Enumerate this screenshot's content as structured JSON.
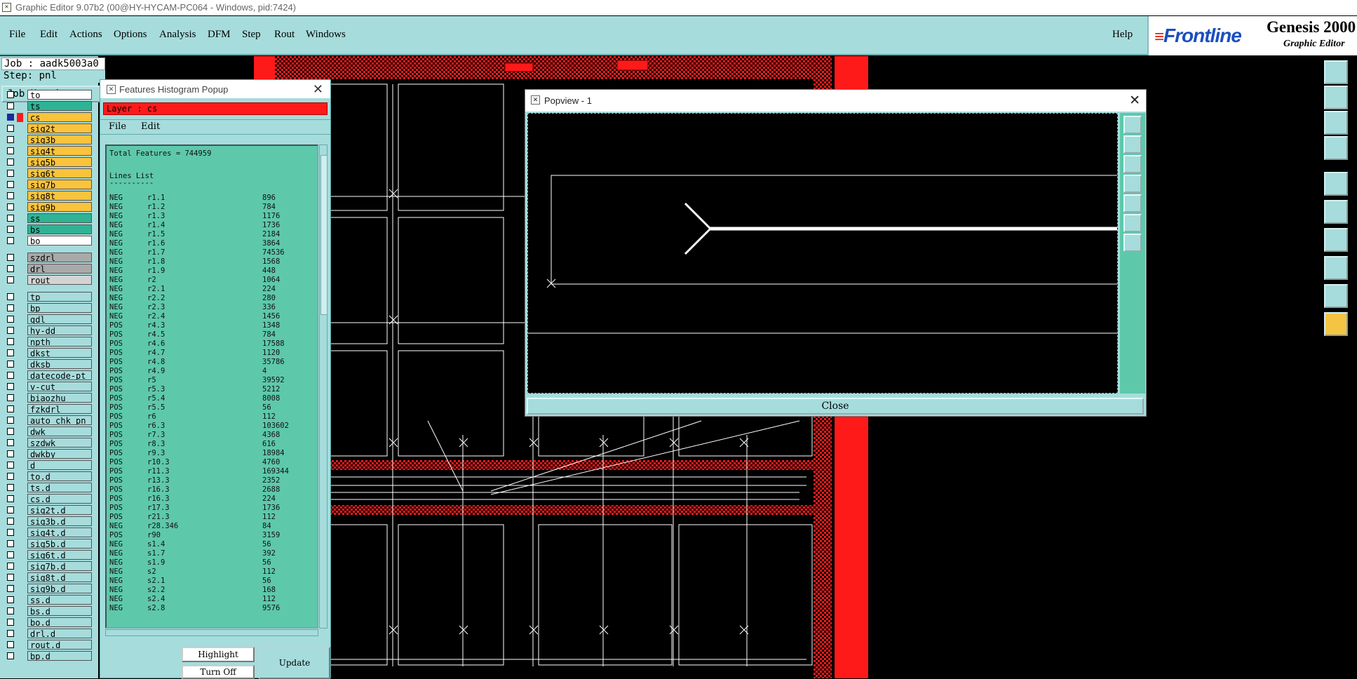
{
  "window": {
    "title": "Graphic Editor 9.07b2 (00@HY-HYCAM-PC064 - Windows, pid:7424)"
  },
  "menubar": {
    "items": [
      "File",
      "Edit",
      "Actions",
      "Options",
      "Analysis",
      "DFM",
      "Step",
      "Rout",
      "Windows"
    ],
    "help": "Help"
  },
  "logo": {
    "brand": "Frontline",
    "product": "Genesis 2000",
    "subtitle": "Graphic Editor"
  },
  "job": {
    "job_line": "Job : aadk5003a0",
    "step_line": "Step: pnl",
    "matrix_button": "Job Matrix ..."
  },
  "layers": [
    {
      "name": "to",
      "color": "#ffffff",
      "selected": false
    },
    {
      "name": "ts",
      "color": "#2fb394",
      "selected": false
    },
    {
      "name": "cs",
      "color": "#f9c33c",
      "selected": true
    },
    {
      "name": "sig2t",
      "color": "#f9c33c",
      "selected": false
    },
    {
      "name": "sig3b",
      "color": "#f9c33c",
      "selected": false
    },
    {
      "name": "sig4t",
      "color": "#f9c33c",
      "selected": false
    },
    {
      "name": "sig5b",
      "color": "#f9c33c",
      "selected": false
    },
    {
      "name": "sig6t",
      "color": "#f9c33c",
      "selected": false
    },
    {
      "name": "sig7b",
      "color": "#f9c33c",
      "selected": false
    },
    {
      "name": "sig8t",
      "color": "#f9c33c",
      "selected": false
    },
    {
      "name": "sig9b",
      "color": "#f9c33c",
      "selected": false
    },
    {
      "name": "ss",
      "color": "#2fb394",
      "selected": false
    },
    {
      "name": "bs",
      "color": "#2fb394",
      "selected": false
    },
    {
      "name": "bo",
      "color": "#ffffff",
      "selected": false
    },
    {
      "name": "szdrl",
      "color": "#a9a9a9",
      "selected": false
    },
    {
      "name": "drl",
      "color": "#a9a9a9",
      "selected": false
    },
    {
      "name": "rout",
      "color": "#d3d3d3",
      "selected": false
    },
    {
      "name": "tp",
      "color": "#a6dcdc",
      "selected": false
    },
    {
      "name": "bp",
      "color": "#a6dcdc",
      "selected": false
    },
    {
      "name": "gdl",
      "color": "#a6dcdc",
      "selected": false
    },
    {
      "name": "hy-dd",
      "color": "#a6dcdc",
      "selected": false
    },
    {
      "name": "npth",
      "color": "#a6dcdc",
      "selected": false
    },
    {
      "name": "dkst",
      "color": "#a6dcdc",
      "selected": false
    },
    {
      "name": "dksb",
      "color": "#a6dcdc",
      "selected": false
    },
    {
      "name": "datecode-pt",
      "color": "#a6dcdc",
      "selected": false
    },
    {
      "name": "v-cut",
      "color": "#a6dcdc",
      "selected": false
    },
    {
      "name": "biaozhu",
      "color": "#a6dcdc",
      "selected": false
    },
    {
      "name": "fzkdrl",
      "color": "#a6dcdc",
      "selected": false
    },
    {
      "name": "auto_chk_pn",
      "color": "#a6dcdc",
      "selected": false
    },
    {
      "name": "dwk",
      "color": "#a6dcdc",
      "selected": false
    },
    {
      "name": "szdwk",
      "color": "#a6dcdc",
      "selected": false
    },
    {
      "name": "dwkby",
      "color": "#a6dcdc",
      "selected": false
    },
    {
      "name": "d",
      "color": "#a6dcdc",
      "selected": false
    },
    {
      "name": "to.d",
      "color": "#a6dcdc",
      "selected": false
    },
    {
      "name": "ts.d",
      "color": "#a6dcdc",
      "selected": false
    },
    {
      "name": "cs.d",
      "color": "#a6dcdc",
      "selected": false
    },
    {
      "name": "sig2t.d",
      "color": "#a6dcdc",
      "selected": false
    },
    {
      "name": "sig3b.d",
      "color": "#a6dcdc",
      "selected": false
    },
    {
      "name": "sig4t.d",
      "color": "#a6dcdc",
      "selected": false
    },
    {
      "name": "sig5b.d",
      "color": "#a6dcdc",
      "selected": false
    },
    {
      "name": "sig6t.d",
      "color": "#a6dcdc",
      "selected": false
    },
    {
      "name": "sig7b.d",
      "color": "#a6dcdc",
      "selected": false
    },
    {
      "name": "sig8t.d",
      "color": "#a6dcdc",
      "selected": false
    },
    {
      "name": "sig9b.d",
      "color": "#a6dcdc",
      "selected": false
    },
    {
      "name": "ss.d",
      "color": "#a6dcdc",
      "selected": false
    },
    {
      "name": "bs.d",
      "color": "#a6dcdc",
      "selected": false
    },
    {
      "name": "bo.d",
      "color": "#a6dcdc",
      "selected": false
    },
    {
      "name": "drl.d",
      "color": "#a6dcdc",
      "selected": false
    },
    {
      "name": "rout.d",
      "color": "#a6dcdc",
      "selected": false
    },
    {
      "name": "bp.d",
      "color": "#a6dcdc",
      "selected": false
    }
  ],
  "histogram": {
    "title": "Features Histogram Popup",
    "layer_line": "Layer :  cs",
    "menu": [
      "File",
      "Edit"
    ],
    "total": "Total Features = 744959",
    "section_title": "Lines List",
    "section_underline": "----------",
    "rows": [
      [
        "NEG",
        "r1.1",
        "896"
      ],
      [
        "NEG",
        "r1.2",
        "784"
      ],
      [
        "NEG",
        "r1.3",
        "1176"
      ],
      [
        "NEG",
        "r1.4",
        "1736"
      ],
      [
        "NEG",
        "r1.5",
        "2184"
      ],
      [
        "NEG",
        "r1.6",
        "3864"
      ],
      [
        "NEG",
        "r1.7",
        "74536"
      ],
      [
        "NEG",
        "r1.8",
        "1568"
      ],
      [
        "NEG",
        "r1.9",
        "448"
      ],
      [
        "NEG",
        "r2",
        "1064"
      ],
      [
        "NEG",
        "r2.1",
        "224"
      ],
      [
        "NEG",
        "r2.2",
        "280"
      ],
      [
        "NEG",
        "r2.3",
        "336"
      ],
      [
        "NEG",
        "r2.4",
        "1456"
      ],
      [
        "POS",
        "r4.3",
        "1348"
      ],
      [
        "POS",
        "r4.5",
        "784"
      ],
      [
        "POS",
        "r4.6",
        "17588"
      ],
      [
        "POS",
        "r4.7",
        "1120"
      ],
      [
        "POS",
        "r4.8",
        "35786"
      ],
      [
        "POS",
        "r4.9",
        "4"
      ],
      [
        "POS",
        "r5",
        "39592"
      ],
      [
        "POS",
        "r5.3",
        "5212"
      ],
      [
        "POS",
        "r5.4",
        "8008"
      ],
      [
        "POS",
        "r5.5",
        "56"
      ],
      [
        "POS",
        "r6",
        "112"
      ],
      [
        "POS",
        "r6.3",
        "103602"
      ],
      [
        "POS",
        "r7.3",
        "4368"
      ],
      [
        "POS",
        "r8.3",
        "616"
      ],
      [
        "POS",
        "r9.3",
        "18984"
      ],
      [
        "POS",
        "r10.3",
        "4760"
      ],
      [
        "POS",
        "r11.3",
        "169344"
      ],
      [
        "POS",
        "r13.3",
        "2352"
      ],
      [
        "POS",
        "r16.3",
        "2688"
      ],
      [
        "POS",
        "r16.3",
        "224"
      ],
      [
        "POS",
        "r17.3",
        "1736"
      ],
      [
        "POS",
        "r21.3",
        "112"
      ],
      [
        "NEG",
        "r28.346",
        "84"
      ],
      [
        "POS",
        "r90",
        "3159"
      ],
      [
        "NEG",
        "s1.4",
        "56"
      ],
      [
        "NEG",
        "s1.7",
        "392"
      ],
      [
        "NEG",
        "s1.9",
        "56"
      ],
      [
        "NEG",
        "s2",
        "112"
      ],
      [
        "NEG",
        "s2.1",
        "56"
      ],
      [
        "NEG",
        "s2.2",
        "168"
      ],
      [
        "NEG",
        "s2.4",
        "112"
      ],
      [
        "NEG",
        "s2.8",
        "9576"
      ]
    ],
    "buttons": {
      "highlight": "Highlight",
      "turn_off": "Turn Off",
      "update": "Update"
    }
  },
  "popview": {
    "title": "Popview - 1",
    "close": "Close"
  },
  "colors": {
    "panel": "#a6dcdc",
    "list_bg": "#5ec8aa",
    "copper_red": "#ff1a1a",
    "layer_yellow": "#f9c33c",
    "brand_blue": "#1b4fbf"
  }
}
